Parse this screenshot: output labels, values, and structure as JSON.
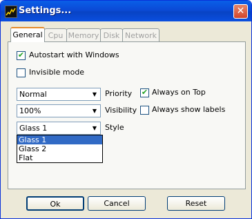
{
  "window": {
    "title": "Settings..."
  },
  "tabs": [
    {
      "label": "General",
      "active": true
    },
    {
      "label": "Cpu",
      "active": false
    },
    {
      "label": "Memory",
      "active": false
    },
    {
      "label": "Disk",
      "active": false
    },
    {
      "label": "Network",
      "active": false
    }
  ],
  "general": {
    "autostart": {
      "label": "Autostart with Windows",
      "checked": true
    },
    "invisible": {
      "label": "Invisible mode",
      "checked": false
    },
    "priority": {
      "label": "Priority",
      "value": "Normal"
    },
    "visibility": {
      "label": "Visibility",
      "value": "100%"
    },
    "style": {
      "label": "Style",
      "value": "Glass 1",
      "options": [
        "Glass 1",
        "Glass 2",
        "Flat"
      ]
    },
    "always_on_top": {
      "label": "Always on Top",
      "checked": true
    },
    "always_show_labels": {
      "label": "Always show labels",
      "checked": false
    }
  },
  "buttons": {
    "ok": "Ok",
    "cancel": "Cancel",
    "reset": "Reset"
  }
}
